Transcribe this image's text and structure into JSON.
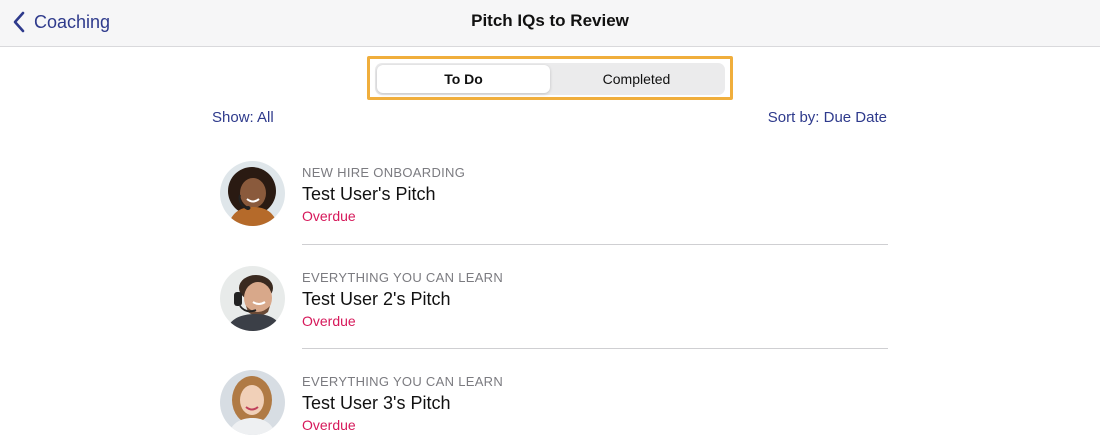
{
  "navbar": {
    "back_label": "Coaching",
    "title": "Pitch IQs to Review"
  },
  "segments": {
    "todo_label": "To Do",
    "completed_label": "Completed",
    "selected": "To Do"
  },
  "filters": {
    "show_label": "Show: All",
    "sort_label": "Sort by: Due Date"
  },
  "items": [
    {
      "category": "NEW HIRE ONBOARDING",
      "title": "Test User's Pitch",
      "status": "Overdue",
      "avatar": "woman-headset-avatar"
    },
    {
      "category": "EVERYTHING YOU CAN LEARN",
      "title": "Test User 2's Pitch",
      "status": "Overdue",
      "avatar": "man-headset-avatar"
    },
    {
      "category": "EVERYTHING YOU CAN LEARN",
      "title": "Test User 3's Pitch",
      "status": "Overdue",
      "avatar": "woman-blonde-avatar"
    }
  ],
  "colors": {
    "accent": "#2e3a8c",
    "overdue": "#d6185a",
    "highlight": "#f0ae3c"
  }
}
